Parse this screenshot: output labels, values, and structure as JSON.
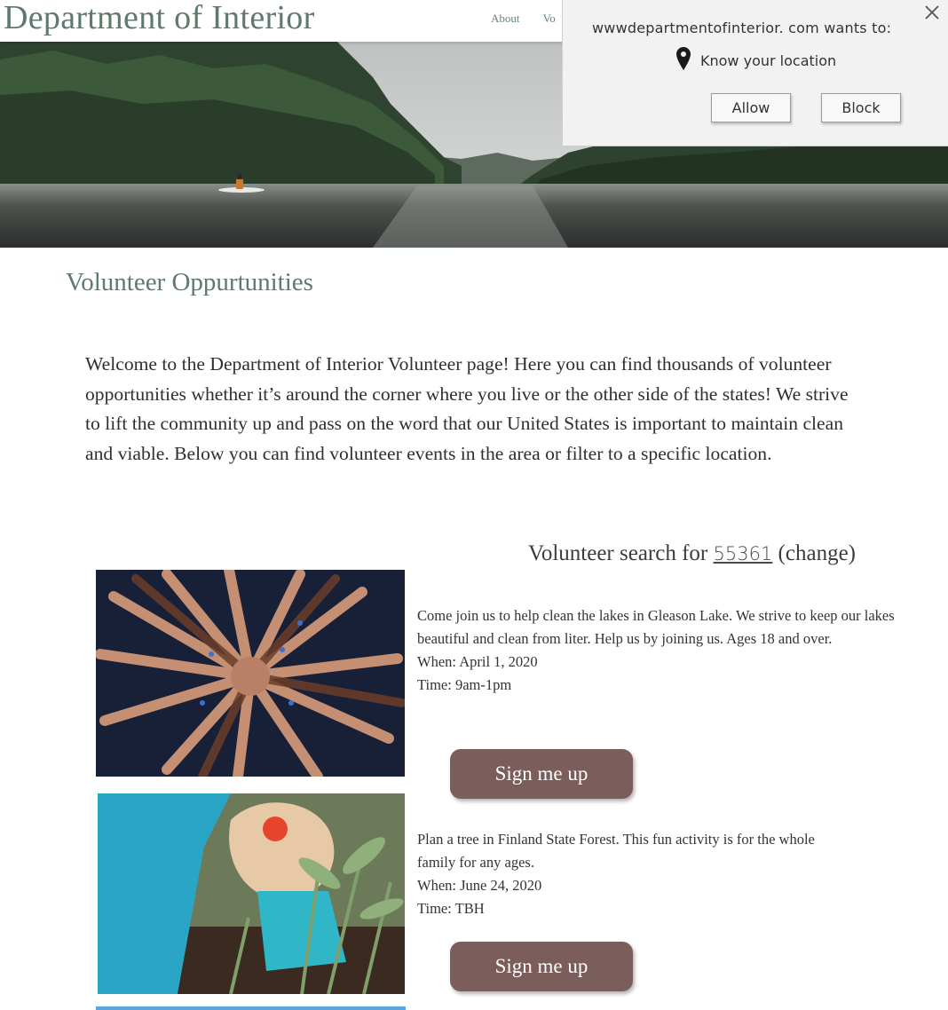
{
  "header": {
    "site_title": "Department of Interior",
    "nav": [
      "About",
      "Vo"
    ]
  },
  "permission_popup": {
    "site_text": "wwwdepartmentofinterior. com wants to:",
    "request_text": "Know your location",
    "allow_label": "Allow",
    "block_label": "Block"
  },
  "page": {
    "heading": "Volunteer Oppurtunities",
    "intro": "Welcome to the Department of Interior Volunteer page! Here you can find thousands of volunteer opportunities whether it’s around the corner where you live or the other side of the states! We strive to lift the community up and pass on the word that our United States is important to maintain clean and viable. Below you can find volunteer events in the area or filter to a specific location.",
    "search": {
      "prefix": "Volunteer search for",
      "zip": "55361",
      "change_label": "(change)"
    }
  },
  "events": [
    {
      "description": "Come join us to help clean the lakes in Gleason Lake. We strive to keep our lakes beautiful and clean from liter. Help us by joining us. Ages 18 and over.",
      "when": "When: April 1, 2020",
      "time": "Time: 9am-1pm",
      "button_label": "Sign me up"
    },
    {
      "description": "Plan a tree in Finland State Forest. This fun activity is for the whole family for any ages.",
      "when": "When: June 24, 2020",
      "time": "Time: TBH",
      "button_label": "Sign me up"
    }
  ],
  "colors": {
    "title_green": "#5f7a6c",
    "button_brown": "#7b5d5b",
    "accent_blue": "#5aa5e0",
    "popup_bg": "#f2f2f2"
  }
}
